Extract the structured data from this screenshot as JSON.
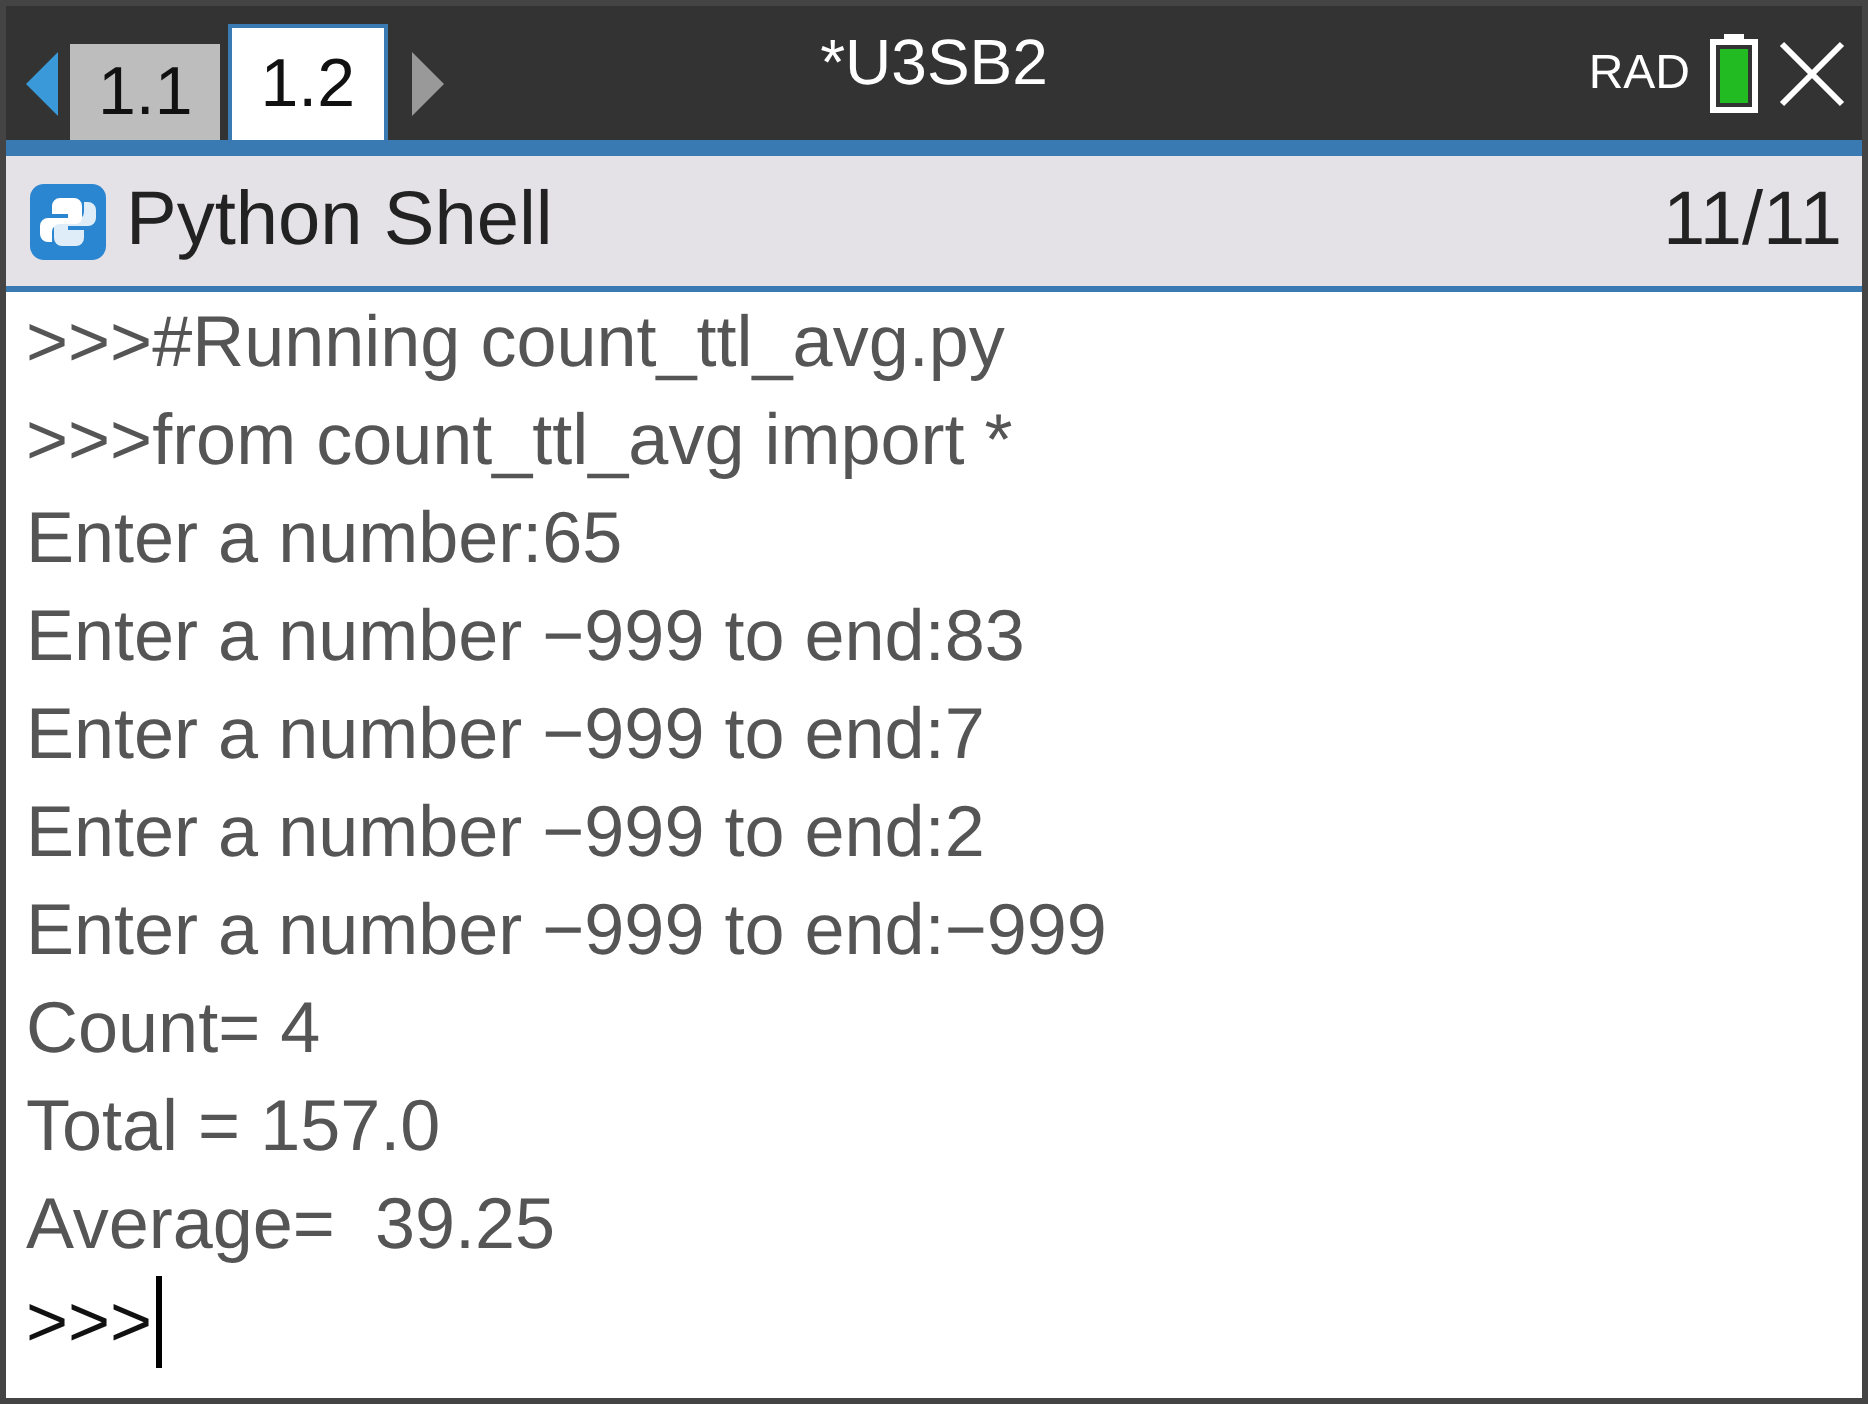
{
  "top_bar": {
    "nav_left": {
      "disabled": false
    },
    "tabs": [
      {
        "label": "1.1",
        "selected": false
      },
      {
        "label": "1.2",
        "selected": true
      }
    ],
    "nav_right": {
      "disabled": true
    },
    "document_title": "*U3SB2",
    "angle_mode": "RAD"
  },
  "app_header": {
    "title": "Python Shell",
    "position": "11/11"
  },
  "shell_lines": [
    {
      "kind": "output",
      "text": ">>>#Running count_ttl_avg.py"
    },
    {
      "kind": "output",
      "text": ">>>from count_ttl_avg import *"
    },
    {
      "kind": "output",
      "text": "Enter a number:65"
    },
    {
      "kind": "output",
      "text": "Enter a number −999 to end:83"
    },
    {
      "kind": "output",
      "text": "Enter a number −999 to end:7"
    },
    {
      "kind": "output",
      "text": "Enter a number −999 to end:2"
    },
    {
      "kind": "output",
      "text": "Enter a number −999 to end:−999"
    },
    {
      "kind": "output",
      "text": "Count= 4"
    },
    {
      "kind": "output",
      "text": "Total = 157.0"
    },
    {
      "kind": "output",
      "text": "Average=  39.25"
    },
    {
      "kind": "prompt",
      "text": ">>>"
    }
  ]
}
